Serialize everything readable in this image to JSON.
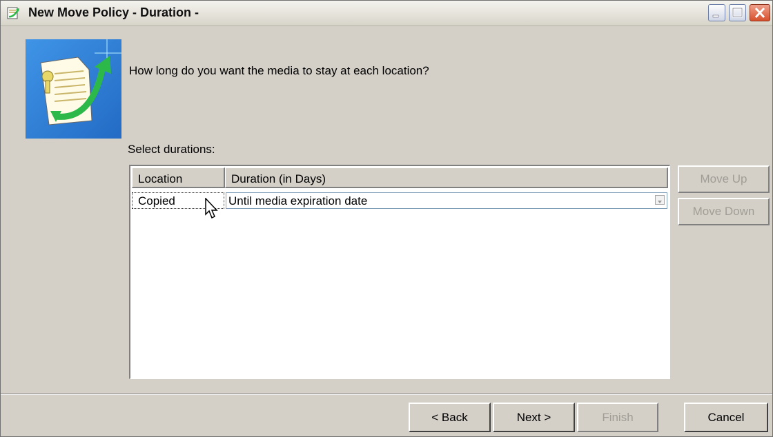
{
  "window": {
    "title": "New Move Policy - Duration -",
    "controls": [
      "minimize-icon",
      "maximize-icon",
      "close-icon"
    ]
  },
  "wizard": {
    "question": "How long do you want the media to stay at each location?",
    "select_label": "Select durations:"
  },
  "table": {
    "columns": [
      "Location",
      "Duration (in Days)"
    ],
    "rows": [
      {
        "location": "Copied",
        "duration": "Until media expiration date"
      }
    ]
  },
  "side_buttons": {
    "move_up": "Move Up",
    "move_down": "Move Down"
  },
  "footer_buttons": {
    "back": "< Back",
    "next": "Next >",
    "finish": "Finish",
    "cancel": "Cancel"
  },
  "colors": {
    "background": "#d4d0c8",
    "disabled_text": "#9f9d96",
    "image_blue": "#2f7fd8",
    "arrow_green": "#2db84a"
  }
}
